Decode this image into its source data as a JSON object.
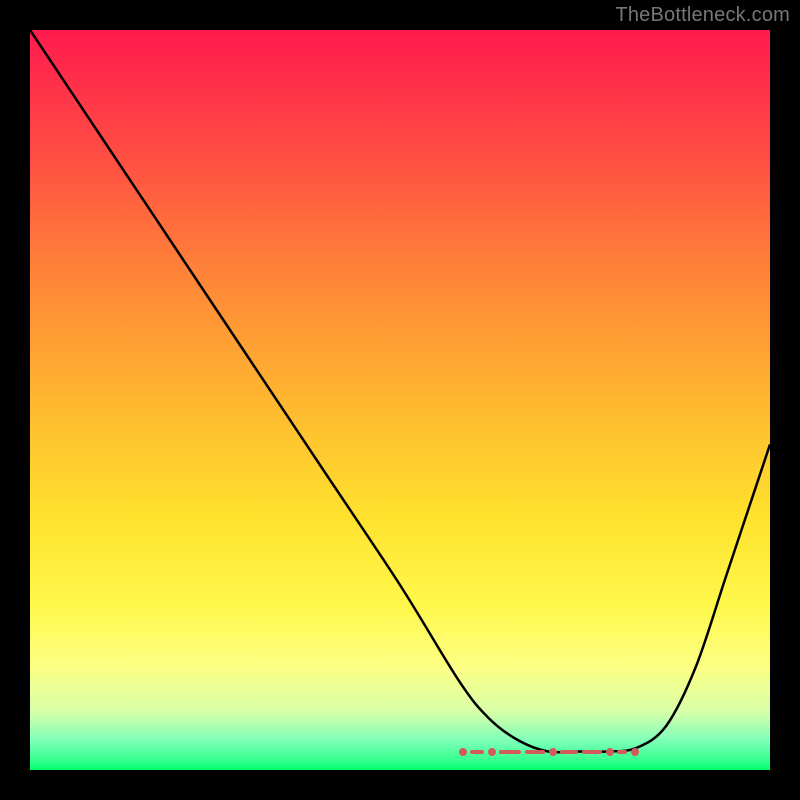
{
  "watermark": "TheBottleneck.com",
  "colors": {
    "background": "#000000",
    "curve": "#000000",
    "marker": "#d15a5a",
    "gradient_top": "#ff1a4d",
    "gradient_bottom": "#00ff66"
  },
  "chart_data": {
    "type": "line",
    "title": "",
    "xlabel": "",
    "ylabel": "",
    "xlim": [
      0,
      100
    ],
    "ylim": [
      0,
      100
    ],
    "grid": false,
    "legend": false,
    "x": [
      0,
      4,
      10,
      20,
      30,
      40,
      50,
      58,
      62,
      66,
      70,
      74,
      78,
      82,
      86,
      90,
      94,
      98,
      100
    ],
    "y": [
      100,
      94,
      85,
      70,
      55,
      40,
      25,
      12,
      7,
      4,
      2.5,
      2.5,
      2.5,
      3,
      6,
      14,
      26,
      38,
      44
    ],
    "marker_region": {
      "x_start": 58,
      "x_end": 83,
      "y": 2.5
    },
    "description": "V-shaped bottleneck curve over a vertical red-to-green gradient. Curve descends from top-left, reaches a flat minimum around x≈58–83, then rises toward the right. Flat minimum marked with salmon dots/dashes."
  }
}
